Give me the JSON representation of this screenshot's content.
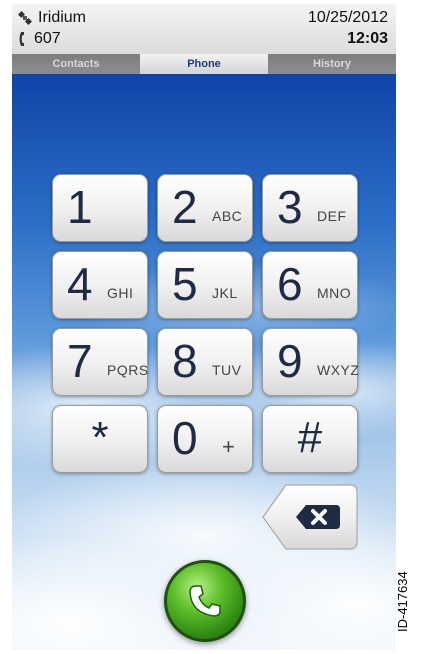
{
  "status": {
    "network": "Iridium",
    "extension": "607",
    "date": "10/25/2012",
    "time": "12:03",
    "icons": {
      "network": "satellite-icon",
      "extension": "handset-icon"
    }
  },
  "tabs": [
    {
      "label": "Contacts",
      "active": false
    },
    {
      "label": "Phone",
      "active": true
    },
    {
      "label": "History",
      "active": false
    }
  ],
  "keypad": [
    {
      "digit": "1",
      "letters": ""
    },
    {
      "digit": "2",
      "letters": "ABC"
    },
    {
      "digit": "3",
      "letters": "DEF"
    },
    {
      "digit": "4",
      "letters": "GHI"
    },
    {
      "digit": "5",
      "letters": "JKL"
    },
    {
      "digit": "6",
      "letters": "MNO"
    },
    {
      "digit": "7",
      "letters": "PQRS"
    },
    {
      "digit": "8",
      "letters": "TUV"
    },
    {
      "digit": "9",
      "letters": "WXYZ"
    },
    {
      "digit": "*",
      "letters": ""
    },
    {
      "digit": "0",
      "letters": "+"
    },
    {
      "digit": "#",
      "letters": ""
    }
  ],
  "actions": {
    "backspace_icon": "backspace-icon",
    "call_icon": "phone-handset-icon"
  },
  "colors": {
    "call_green": "#3fa01a",
    "tab_active_text": "#1b3d79",
    "sky_top": "#0f44a8"
  },
  "figure_id": "ID-417634"
}
